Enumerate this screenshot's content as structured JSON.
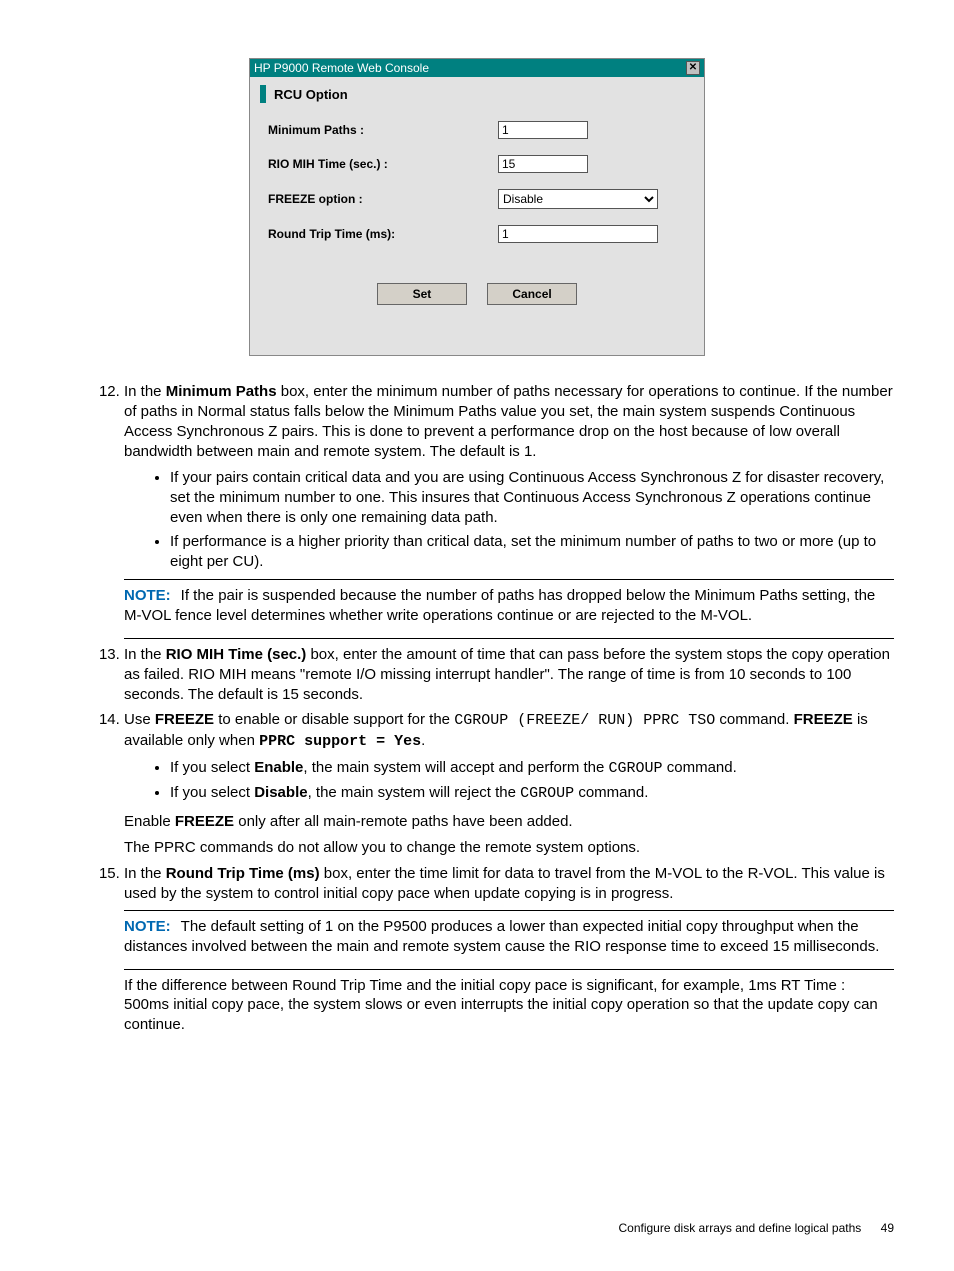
{
  "dialog": {
    "title": "HP P9000 Remote Web Console",
    "section": "RCU Option",
    "fields": {
      "min_paths_label": "Minimum Paths :",
      "min_paths_value": "1",
      "rio_mih_label": "RIO MIH Time (sec.) :",
      "rio_mih_value": "15",
      "freeze_label": "FREEZE option :",
      "freeze_value": "Disable",
      "rtt_label": "Round Trip Time (ms):",
      "rtt_value": "1"
    },
    "buttons": {
      "set": "Set",
      "cancel": "Cancel"
    }
  },
  "steps": {
    "s12_lead": "In the ",
    "s12_b": "Minimum Paths",
    "s12_tail": " box, enter the minimum number of paths necessary for operations to continue. If the number of paths in Normal status falls below the Minimum Paths value you set, the main system suspends Continuous Access Synchronous Z pairs. This is done to prevent a performance drop on the host because of low overall bandwidth between main and remote system. The default is 1.",
    "s12_b1": "If your pairs contain critical data and you are using Continuous Access Synchronous Z for disaster recovery, set the minimum number to one. This insures that Continuous Access Synchronous Z operations continue even when there is only one remaining data path.",
    "s12_b2": "If performance is a higher priority than critical data, set the minimum number of paths to two or more (up to eight per CU).",
    "s12_note": "If the pair is suspended because the number of paths has dropped below the Minimum Paths setting, the M-VOL fence level determines whether write operations continue or are rejected to the M-VOL.",
    "s13_lead": "In the ",
    "s13_b": "RIO MIH Time (sec.)",
    "s13_tail": " box, enter the amount of time that can pass before the system stops the copy operation as failed. RIO MIH means \"remote I/O missing interrupt handler\". The range of time is from 10 seconds to 100 seconds. The default is 15 seconds.",
    "s14_p1_a": "Use ",
    "s14_p1_b": "FREEZE",
    "s14_p1_c": " to enable or disable support for the ",
    "s14_p1_code": "CGROUP (FREEZE/ RUN) PPRC TSO",
    "s14_p1_d": " command. ",
    "s14_p1_e": "FREEZE",
    "s14_p1_f": " is available only when ",
    "s14_p1_code2": "PPRC support = Yes",
    "s14_p1_g": ".",
    "s14_b1_a": "If you select ",
    "s14_b1_b": "Enable",
    "s14_b1_c": ", the main system will accept and perform the ",
    "s14_b1_code": "CGROUP",
    "s14_b1_d": " command.",
    "s14_b2_a": "If you select ",
    "s14_b2_b": "Disable",
    "s14_b2_c": ", the main system will reject the ",
    "s14_b2_code": "CGROUP",
    "s14_b2_d": " command.",
    "s14_p2_a": "Enable ",
    "s14_p2_b": "FREEZE",
    "s14_p2_c": " only after all main-remote paths have been added.",
    "s14_p3": "The PPRC commands do not allow you to change the remote system options.",
    "s15_lead": "In the ",
    "s15_b": "Round Trip Time (ms)",
    "s15_tail": " box, enter the time limit for data to travel from the M-VOL to the R-VOL. This value is used by the system to control initial copy pace when update copying is in progress.",
    "s15_note": "The default setting of 1 on the P9500 produces a lower than expected initial copy throughput when the distances involved between the main and remote system cause the RIO response time to exceed 15 milliseconds.",
    "s15_p2": "If the difference between Round Trip Time and the initial copy pace is significant, for example, 1ms RT Time : 500ms initial copy pace, the system slows or even interrupts the initial copy operation so that the update copy can continue."
  },
  "note_label": "NOTE:",
  "footer": {
    "text": "Configure disk arrays and define logical paths",
    "page": "49"
  }
}
